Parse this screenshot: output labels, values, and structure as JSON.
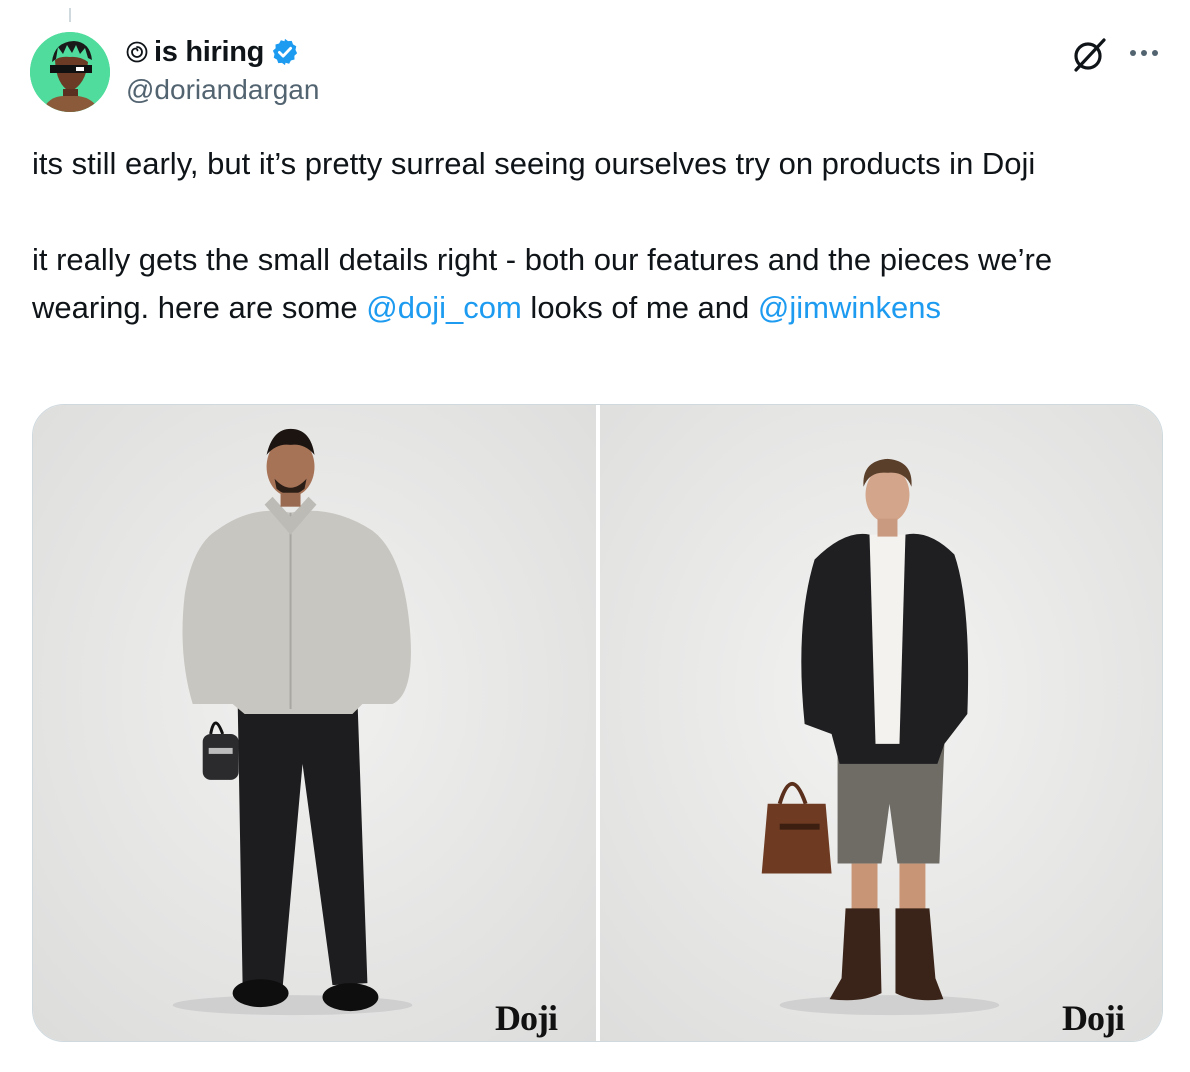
{
  "author": {
    "display_name": "is hiring",
    "handle": "@doriandargan",
    "avatar_icon": "avatar-image",
    "verified": true,
    "verified_color": "#1d9bf0"
  },
  "tweet": {
    "line1": "its still early, but it’s pretty surreal seeing ourselves try on products in Doji",
    "line2_prefix": "it really gets the small details right - both our features and the pieces we’re wearing. here are some ",
    "mention1": "@doji_com",
    "line2_middle": " looks of me and ",
    "mention2": "@jimwinkens",
    "mention_color": "#1d9bf0"
  },
  "media": {
    "photos": [
      {
        "watermark": "Doji"
      },
      {
        "watermark": "Doji"
      }
    ]
  },
  "icons": {
    "grok": "grok-icon",
    "more": "more-icon",
    "spiral": "spiral-icon",
    "verified": "verified-badge-icon"
  }
}
